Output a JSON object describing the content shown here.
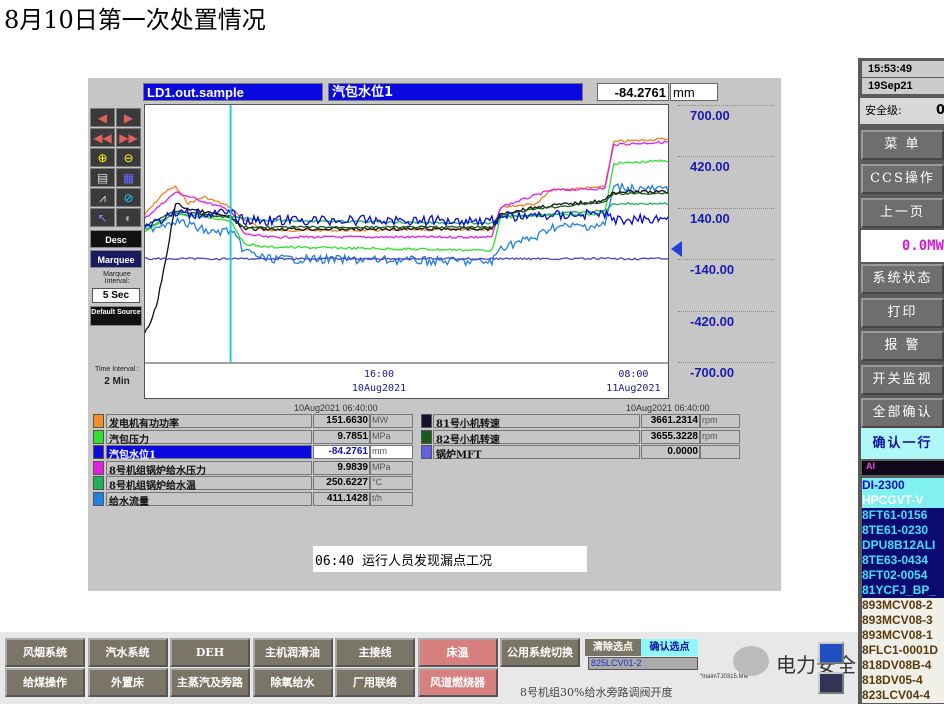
{
  "page_title": "8月10日第一次处置情况",
  "header": {
    "tag": "LD1.out.sample",
    "description": "汽包水位1",
    "value": "-84.2761",
    "unit": "mm"
  },
  "toolbar": {
    "desc": "Desc",
    "marquee": "Marquee",
    "marquee_interval_label": "Marquee Interval:",
    "marquee_interval": "5 Sec",
    "default_source": "Default Source",
    "time_interval_label": "Time Interval :",
    "time_interval": "2 Min"
  },
  "legend": {
    "left_time": "10Aug2021  06:40:00",
    "right_time": "10Aug2021  06:40:00",
    "left": [
      {
        "name": "发电机有功功率",
        "value": "151.6630",
        "unit": "MW",
        "color": "#f09020"
      },
      {
        "name": "汽包压力",
        "value": "9.7851",
        "unit": "MPa",
        "color": "#30e030"
      },
      {
        "name": "汽包水位1",
        "value": "-84.2761",
        "unit": "mm",
        "color": "#0a0ad0",
        "selected": true
      },
      {
        "name": "8号机组锅炉给水压力",
        "value": "9.9839",
        "unit": "MPa",
        "color": "#e020e0"
      },
      {
        "name": "8号机组锅炉给水温",
        "value": "250.6227",
        "unit": "°C",
        "color": "#20b060"
      },
      {
        "name": "给水流量",
        "value": "411.1428",
        "unit": "t/h",
        "color": "#2080e0"
      }
    ],
    "right": [
      {
        "name": "81号小机转速",
        "value": "3661.2314",
        "unit": "rpm",
        "color": "#101030"
      },
      {
        "name": "82号小机转速",
        "value": "3655.3228",
        "unit": "rpm",
        "color": "#1a5a1a"
      },
      {
        "name": "锅炉MFT",
        "value": "0.0000",
        "unit": "",
        "color": "#6060e0"
      }
    ]
  },
  "annotation": "06:40 运行人员发现漏点工况",
  "chart_data": {
    "type": "line",
    "yticks": [
      700,
      420,
      140,
      -140,
      -420,
      -700
    ],
    "ylim": [
      -700,
      700
    ],
    "xticks": [
      {
        "time": "16:00",
        "date": "10Aug2021"
      },
      {
        "time": "08:00",
        "date": "11Aug2021"
      }
    ],
    "xlim": [
      "10Aug2021 01:08",
      "11Aug2021 10:28"
    ],
    "cursor": "10Aug2021 06:40",
    "series": [
      {
        "color": "#f08020",
        "points": [
          [
            "10Aug2021 01:08",
            95
          ],
          [
            "10Aug2021 02:30",
            230
          ],
          [
            "10Aug2021 03:12",
            260
          ],
          [
            "10Aug2021 04:00",
            170
          ],
          [
            "10Aug2021 05:00",
            205
          ],
          [
            "10Aug2021 06:40",
            150
          ],
          [
            "10Aug2021 07:30",
            77
          ],
          [
            "10Aug2021 08:54",
            23
          ],
          [
            "10Aug2021 17:00",
            23
          ],
          [
            "10Aug2021 23:06",
            30
          ],
          [
            "10Aug2021 23:40",
            150
          ],
          [
            "11Aug2021 01:56",
            168
          ],
          [
            "11Aug2021 02:48",
            241
          ],
          [
            "11Aug2021 06:12",
            259
          ],
          [
            "11Aug2021 06:46",
            505
          ],
          [
            "11Aug2021 10:28",
            523
          ]
        ]
      },
      {
        "color": "#e020e0",
        "points": [
          [
            "10Aug2021 01:08",
            77
          ],
          [
            "10Aug2021 03:12",
            230
          ],
          [
            "10Aug2021 06:40",
            132
          ],
          [
            "10Aug2021 07:30",
            5
          ],
          [
            "10Aug2021 08:54",
            -14
          ],
          [
            "10Aug2021 23:06",
            -14
          ],
          [
            "10Aug2021 23:40",
            150
          ],
          [
            "11Aug2021 02:48",
            241
          ],
          [
            "11Aug2021 06:12",
            250
          ],
          [
            "11Aug2021 06:46",
            490
          ],
          [
            "11Aug2021 10:28",
            505
          ]
        ]
      },
      {
        "color": "#30e030",
        "points": [
          [
            "10Aug2021 01:08",
            5
          ],
          [
            "10Aug2021 03:12",
            114
          ],
          [
            "10Aug2021 06:40",
            77
          ],
          [
            "10Aug2021 07:30",
            -50
          ],
          [
            "10Aug2021 08:54",
            -68
          ],
          [
            "10Aug2021 23:06",
            -86
          ],
          [
            "10Aug2021 23:40",
            95
          ],
          [
            "11Aug2021 06:12",
            114
          ],
          [
            "11Aug2021 06:46",
            386
          ],
          [
            "11Aug2021 10:28",
            405
          ]
        ]
      },
      {
        "color": "#20b060",
        "points": [
          [
            "10Aug2021 01:08",
            23
          ],
          [
            "10Aug2021 03:12",
            114
          ],
          [
            "10Aug2021 06:40",
            95
          ],
          [
            "10Aug2021 08:54",
            77
          ],
          [
            "10Aug2021 23:06",
            60
          ],
          [
            "10Aug2021 23:40",
            95
          ],
          [
            "11Aug2021 06:12",
            130
          ],
          [
            "11Aug2021 06:46",
            168
          ],
          [
            "11Aug2021 10:28",
            168
          ]
        ]
      },
      {
        "color": "#2080e0",
        "points": [
          [
            "10Aug2021 01:08",
            23
          ],
          [
            "10Aug2021 03:12",
            77
          ],
          [
            "10Aug2021 05:30",
            10
          ],
          [
            "10Aug2021 06:40",
            23
          ],
          [
            "10Aug2021 07:30",
            -86
          ],
          [
            "10Aug2021 08:54",
            -132
          ],
          [
            "10Aug2021 17:00",
            -140
          ],
          [
            "10Aug2021 23:06",
            -150
          ],
          [
            "10Aug2021 23:40",
            -68
          ],
          [
            "11Aug2021 01:56",
            -14
          ],
          [
            "11Aug2021 02:48",
            41
          ],
          [
            "11Aug2021 06:12",
            50
          ],
          [
            "11Aug2021 06:46",
            259
          ],
          [
            "11Aug2021 10:28",
            241
          ]
        ]
      },
      {
        "color": "#101010",
        "points": [
          [
            "10Aug2021 01:08",
            -550
          ],
          [
            "10Aug2021 01:30",
            -510
          ],
          [
            "10Aug2021 02:00",
            -390
          ],
          [
            "10Aug2021 02:20",
            -250
          ],
          [
            "10Aug2021 02:40",
            -100
          ],
          [
            "10Aug2021 03:12",
            168
          ],
          [
            "10Aug2021 04:00",
            140
          ],
          [
            "10Aug2021 06:40",
            95
          ],
          [
            "10Aug2021 07:30",
            30
          ],
          [
            "10Aug2021 23:06",
            30
          ],
          [
            "10Aug2021 23:40",
            114
          ],
          [
            "11Aug2021 01:56",
            150
          ],
          [
            "11Aug2021 06:12",
            186
          ],
          [
            "11Aug2021 06:46",
            232
          ],
          [
            "11Aug2021 10:28",
            232
          ]
        ]
      },
      {
        "color": "#1a5a1a",
        "points": [
          [
            "10Aug2021 01:08",
            40
          ],
          [
            "10Aug2021 03:12",
            130
          ],
          [
            "10Aug2021 06:40",
            90
          ],
          [
            "10Aug2021 07:30",
            40
          ],
          [
            "10Aug2021 23:06",
            40
          ],
          [
            "10Aug2021 23:40",
            105
          ],
          [
            "11Aug2021 01:56",
            140
          ],
          [
            "11Aug2021 06:12",
            176
          ],
          [
            "11Aug2021 06:46",
            222
          ],
          [
            "11Aug2021 10:28",
            226
          ]
        ]
      },
      {
        "color": "#0a0ad0",
        "points": [
          [
            "10Aug2021 01:08",
            41
          ],
          [
            "10Aug2021 03:12",
            114
          ],
          [
            "10Aug2021 06:40",
            114
          ],
          [
            "10Aug2021 07:30",
            77
          ],
          [
            "10Aug2021 23:06",
            77
          ],
          [
            "10Aug2021 23:40",
            95
          ],
          [
            "11Aug2021 06:12",
            114
          ],
          [
            "11Aug2021 06:46",
            77
          ],
          [
            "11Aug2021 10:28",
            95
          ]
        ]
      },
      {
        "color": "#4848c8",
        "points": [
          [
            "10Aug2021 01:08",
            -132
          ],
          [
            "11Aug2021 10:28",
            -132
          ]
        ]
      }
    ]
  },
  "bottom": {
    "row1": [
      "风烟系统",
      "汽水系统",
      "DEH",
      "主机润滑油",
      "主接线",
      "床温",
      "公用系统切换"
    ],
    "row2": [
      "给煤操作",
      "外置床",
      "主蒸汽及旁路",
      "除氧给水",
      "厂用联络",
      "风道燃烧器"
    ],
    "clear_points": "清除选点",
    "confirm_points": "确认选点",
    "point_input": "825LCV01-2",
    "display_path": "\"main\\TJ0315.MM\"",
    "caption": "8号机组30%给水旁路调阀开度",
    "watermark": "电力安全"
  },
  "right_panel": {
    "time": "15:53:49",
    "date": "19Sep21",
    "safety_label": "安全级:",
    "safety_value": "0",
    "buttons": [
      "菜 单",
      "CCS操作",
      "上一页"
    ],
    "mw": "0.0MW",
    "buttons2": [
      "系统状态",
      "打印",
      "报 警",
      "开关监视",
      "全部确认"
    ],
    "confirm_row": "确认一行",
    "alarm_header": "AI",
    "alarms": [
      {
        "text": "DI-2300",
        "color": "#1010c0",
        "bg": "#80f0f0"
      },
      {
        "text": "HPCGVT-V",
        "color": "#ffffff",
        "bg": "#80f0f0"
      },
      {
        "text": "8FT61-0156",
        "color": "#40e0ff",
        "bg": "#0a0a70"
      },
      {
        "text": "8TE61-0230",
        "color": "#40e0ff",
        "bg": "#0a0a70"
      },
      {
        "text": "DPU8B12ALI",
        "color": "#40e0ff",
        "bg": "#0a0a70"
      },
      {
        "text": "8TE63-0434",
        "color": "#40e0ff",
        "bg": "#0a0a70"
      },
      {
        "text": "8FT02-0054",
        "color": "#40e0ff",
        "bg": "#0a0a70"
      },
      {
        "text": "81YCFJ_BP_",
        "color": "#40e0ff",
        "bg": "#0a0a70"
      },
      {
        "text": "893MCV08-2",
        "color": "#5a3a10",
        "bg": "#f0f0e8"
      },
      {
        "text": "893MCV08-3",
        "color": "#5a3a10",
        "bg": "#f0f0e8"
      },
      {
        "text": "893MCV08-1",
        "color": "#5a3a10",
        "bg": "#f0f0e8"
      },
      {
        "text": "8FLC1-0001D",
        "color": "#5a3a10",
        "bg": "#f0f0e8"
      },
      {
        "text": "818DV08B-4",
        "color": "#5a3a10",
        "bg": "#f0f0e8"
      },
      {
        "text": "818DV05-4",
        "color": "#5a3a10",
        "bg": "#f0f0e8"
      },
      {
        "text": "823LCV04-4",
        "color": "#5a3a10",
        "bg": "#f0f0e8"
      }
    ]
  }
}
